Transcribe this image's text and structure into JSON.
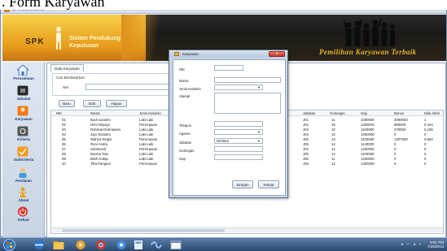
{
  "caption": ". Form Karyawan",
  "window": {
    "title": "SPK KARYAWAN"
  },
  "banner": {
    "logo": "SPK",
    "tagline_1": "Sistem Pendukung",
    "tagline_2": "Keputusan",
    "slogan": "Pemilihan Karyawan Terbaik"
  },
  "sidebar": {
    "items": [
      {
        "label": "Perusahaan",
        "icon": "home-icon",
        "color": "#3a78c8"
      },
      {
        "label": "Jabatan",
        "icon": "briefcase-icon",
        "color": "#2b2b2b"
      },
      {
        "label": "Karyawan",
        "icon": "employee-icon",
        "color": "#f07a1a"
      },
      {
        "label": "Kriteria",
        "icon": "criteria-icon",
        "color": "#555555"
      },
      {
        "label": "SubKriteria",
        "icon": "subcriteria-icon",
        "color": "#f29a1a"
      },
      {
        "label": "Penilaian",
        "icon": "assessment-icon",
        "color": "#3aa0d8"
      },
      {
        "label": "About",
        "icon": "about-icon",
        "color": "#e8a51a"
      },
      {
        "label": "Keluar",
        "icon": "exit-icon",
        "color": "#d8312a"
      }
    ]
  },
  "main": {
    "tab": "Data Karyawan",
    "search": {
      "legend": "Cari Berdasarkan",
      "label": "NIK",
      "value": ""
    },
    "buttons": {
      "new": "Baru",
      "edit": "Edit",
      "delete": "Hapus"
    }
  },
  "table": {
    "headers": {
      "nik": "NIK",
      "nama": "Nama",
      "jk": "Jenis Kelamin",
      "jabatan": "Jabatan",
      "golongan": "Golongan",
      "gaji": "Gaji",
      "bonus": "Bonus",
      "nilai": "Nilai Akhir"
    },
    "rows": [
      {
        "nik": "01",
        "nama": "Budi susanto",
        "jk": "Laki-Laki",
        "jabatan": "J01",
        "golongan": "11",
        "gaji": "1000000",
        "bonus": "2000000",
        "nilai": "1"
      },
      {
        "nik": "02",
        "nama": "Heni Wiyayo",
        "jk": "Perempuan",
        "jabatan": "J02",
        "golongan": "15",
        "gaji": "1200000",
        "bonus": "888400",
        "nilai": "0.444"
      },
      {
        "nik": "03",
        "nama": "Rahmat Darmawan",
        "jk": "Laki-Laki",
        "jabatan": "J03",
        "golongan": "10",
        "gaji": "1100000",
        "bonus": "370000",
        "nilai": "0.185"
      },
      {
        "nik": "04",
        "nama": "Jojo Susanto",
        "jk": "Laki-Laki",
        "jabatan": "J04",
        "golongan": "12",
        "gaji": "1300000",
        "bonus": "0",
        "nilai": "0"
      },
      {
        "nik": "05",
        "nama": "Wahyu Ningsi",
        "jk": "Perempuan",
        "jabatan": "J05",
        "golongan": "13",
        "gaji": "1100000",
        "bonus": "1307600",
        "nilai": "0.654"
      },
      {
        "nik": "06",
        "nama": "Roni Andra",
        "jk": "Laki-Laki",
        "jabatan": "J06",
        "golongan": "12",
        "gaji": "1140000",
        "bonus": "0",
        "nilai": "0"
      },
      {
        "nik": "07",
        "nama": "Subiknodi",
        "jk": "Perempuan",
        "jabatan": "J03",
        "golongan": "12",
        "gaji": "1450000",
        "bonus": "0",
        "nilai": "0"
      },
      {
        "nik": "08",
        "nama": "Darma Tias",
        "jk": "Laki-Laki",
        "jabatan": "J05",
        "golongan": "14",
        "gaji": "1100000",
        "bonus": "0",
        "nilai": "0"
      },
      {
        "nik": "09",
        "nama": "Betih Indap",
        "jk": "Laki-Laki",
        "jabatan": "J06",
        "golongan": "11",
        "gaji": "1200000",
        "bonus": "0",
        "nilai": "0"
      },
      {
        "nik": "10",
        "nama": "Tika Pangam",
        "jk": "Perempuan",
        "jabatan": "J06",
        "golongan": "12",
        "gaji": "1300000",
        "bonus": "0",
        "nilai": "0"
      }
    ]
  },
  "dialog": {
    "title": "Karyawan",
    "close": "x",
    "fields": {
      "nik": "NIK",
      "nama": "Nama",
      "jk": "Jenis Kelamin",
      "alamat": "Alamat",
      "telepon": "Telepon",
      "agama": "Agama",
      "jabatan": "Jabatan",
      "jabatan_value": "Direktur",
      "golongan": "Golongan",
      "gaji": "Gaji"
    },
    "buttons": {
      "save": "Simpan",
      "exit": "Keluar"
    }
  },
  "taskbar": {
    "time": "9:01 PM",
    "date": "7/28/2013"
  }
}
